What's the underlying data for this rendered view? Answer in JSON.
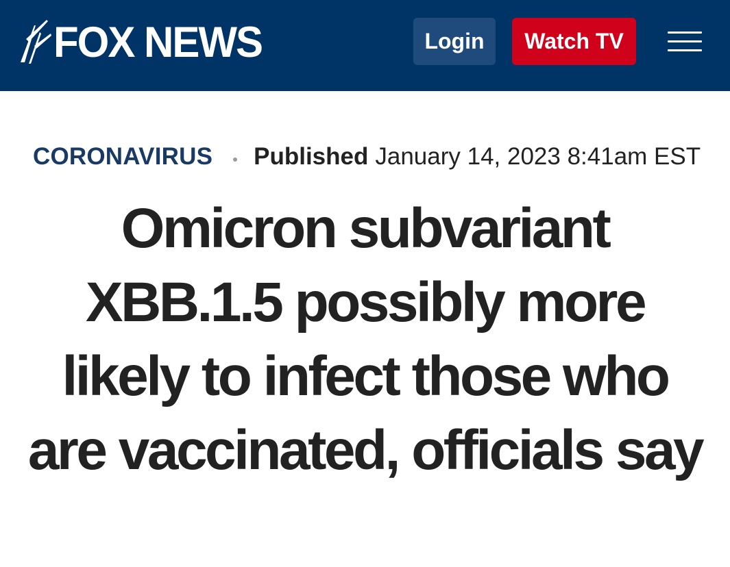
{
  "header": {
    "logo_text": "FOX NEWS",
    "login_label": "Login",
    "watch_label": "Watch TV",
    "menu_icon": "hamburger-menu-icon",
    "colors": {
      "background": "#003366",
      "login_button": "#1f4a7c",
      "watch_button": "#d0021b"
    }
  },
  "article": {
    "category": "CORONAVIRUS",
    "published_label": "Published",
    "published_date": "January 14, 2023 8:41am EST",
    "headline": "Omicron subvariant XBB.1.5 possibly more likely to infect those who are vaccinated, officials say"
  }
}
